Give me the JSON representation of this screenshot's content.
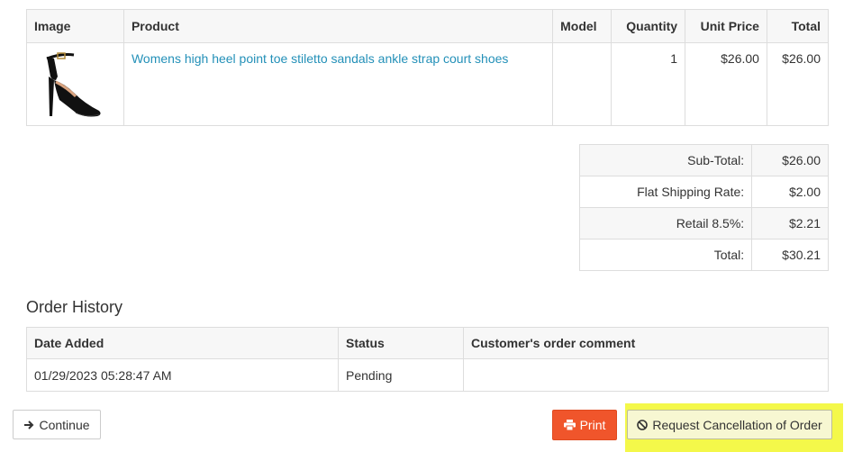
{
  "product_table": {
    "headers": {
      "image": "Image",
      "product": "Product",
      "model": "Model",
      "quantity": "Quantity",
      "unit_price": "Unit Price",
      "total": "Total"
    },
    "row": {
      "product_name": "Womens high heel point toe stiletto sandals ankle strap court shoes",
      "model": "",
      "quantity": "1",
      "unit_price": "$26.00",
      "total": "$26.00"
    }
  },
  "totals": [
    {
      "label": "Sub-Total:",
      "value": "$26.00"
    },
    {
      "label": "Flat Shipping Rate:",
      "value": "$2.00"
    },
    {
      "label": "Retail 8.5%:",
      "value": "$2.21"
    },
    {
      "label": "Total:",
      "value": "$30.21"
    }
  ],
  "order_history": {
    "title": "Order History",
    "headers": {
      "date_added": "Date Added",
      "status": "Status",
      "comment": "Customer's order comment"
    },
    "rows": [
      {
        "date_added": "01/29/2023 05:28:47 AM",
        "status": "Pending",
        "comment": ""
      }
    ]
  },
  "buttons": {
    "continue": "Continue",
    "print": "Print",
    "cancel": "Request Cancellation of Order"
  },
  "colors": {
    "link": "#2390b8",
    "print_button": "#f0552b",
    "highlight": "#f4f84a"
  },
  "icons": {
    "continue": "arrow-right-icon",
    "print": "print-icon",
    "cancel": "ban-icon"
  }
}
